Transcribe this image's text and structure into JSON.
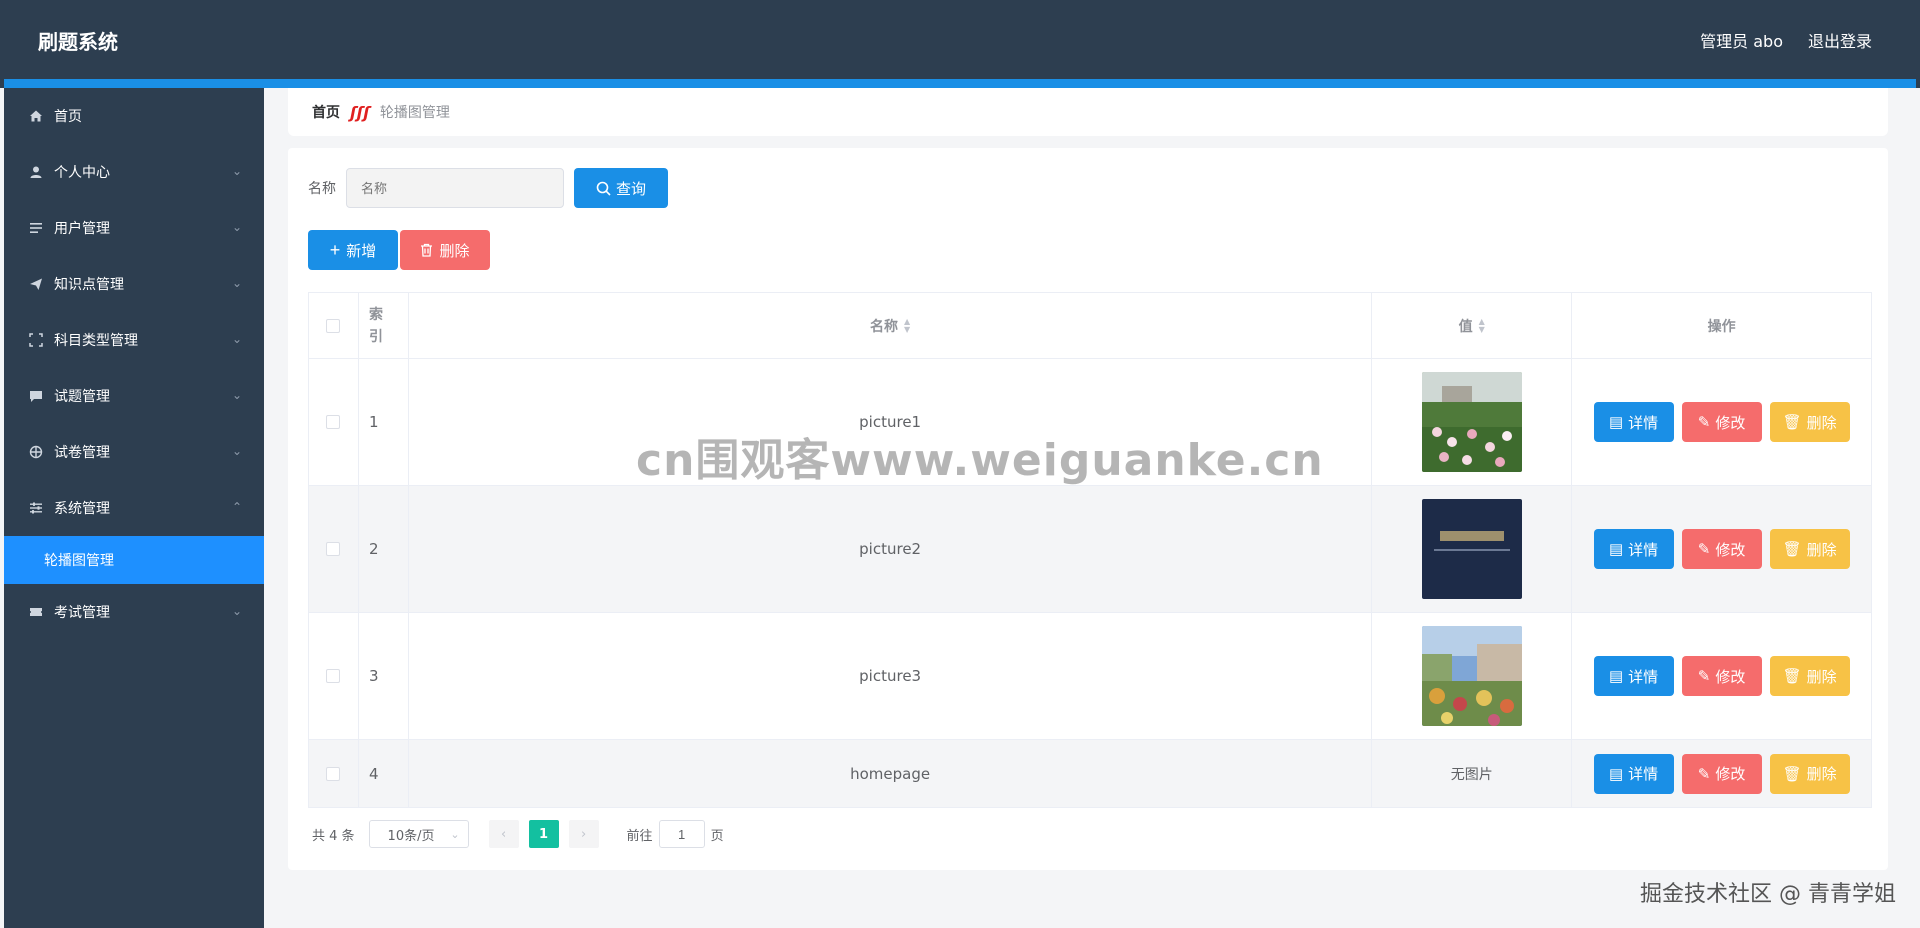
{
  "header": {
    "brand": "刷题系统",
    "user": "管理员 abo",
    "logout": "退出登录"
  },
  "sidebar": {
    "items": [
      {
        "label": "首页",
        "icon": "home-icon",
        "chevron": false
      },
      {
        "label": "个人中心",
        "icon": "user-icon",
        "chevron": true
      },
      {
        "label": "用户管理",
        "icon": "list-icon",
        "chevron": true
      },
      {
        "label": "知识点管理",
        "icon": "send-icon",
        "chevron": true
      },
      {
        "label": "科目类型管理",
        "icon": "fullscreen-icon",
        "chevron": true
      },
      {
        "label": "试题管理",
        "icon": "chat-icon",
        "chevron": true
      },
      {
        "label": "试卷管理",
        "icon": "target-icon",
        "chevron": true
      },
      {
        "label": "系统管理",
        "icon": "sliders-icon",
        "chevron": true,
        "expanded": true
      },
      {
        "label": "考试管理",
        "icon": "ticket-icon",
        "chevron": true
      }
    ],
    "active_sub": "轮播图管理"
  },
  "breadcrumb": {
    "home": "首页",
    "current": "轮播图管理"
  },
  "search": {
    "label": "名称",
    "placeholder": "名称",
    "button": "查询"
  },
  "actions": {
    "add": "新增",
    "delete": "删除"
  },
  "table": {
    "headers": {
      "index": "索引",
      "name": "名称",
      "value": "值",
      "ops": "操作"
    },
    "ops": {
      "detail": "详情",
      "edit": "修改",
      "delete": "删除"
    },
    "rows": [
      {
        "index": "1",
        "name": "picture1",
        "image": "garden-roses"
      },
      {
        "index": "2",
        "name": "picture2",
        "image": "dark-logo-banner"
      },
      {
        "index": "3",
        "name": "picture3",
        "image": "campus-flowers"
      },
      {
        "index": "4",
        "name": "homepage",
        "value": "无图片"
      }
    ]
  },
  "pager": {
    "total": "共 4 条",
    "size": "10条/页",
    "page": "1",
    "goto_prefix": "前往",
    "goto_value": "1",
    "goto_suffix": "页"
  },
  "watermark": "cn围观客www.weiguanke.cn",
  "corner_text": "掘金技术社区 @ 青青学姐",
  "colors": {
    "header": "#2d3e50",
    "accent": "#1a8fe6",
    "danger": "#f56c6c",
    "warning": "#f7c246",
    "pager_active": "#13c0a0"
  }
}
